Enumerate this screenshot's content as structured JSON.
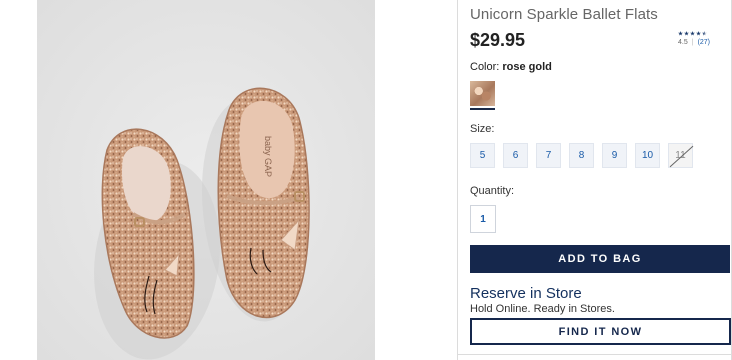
{
  "product": {
    "title": "Unicorn Sparkle Ballet Flats",
    "price": "$29.95",
    "image_alt": "Unicorn Sparkle Ballet Flats in rose gold glitter",
    "insole_brand": "baby GAP"
  },
  "rating": {
    "score": "4.5",
    "count": "(27)",
    "stars_value": 4.5,
    "stars_max": 5
  },
  "color": {
    "label": "Color:",
    "value": "rose gold"
  },
  "size": {
    "label": "Size:",
    "options": [
      {
        "label": "5",
        "available": true
      },
      {
        "label": "6",
        "available": true
      },
      {
        "label": "7",
        "available": true
      },
      {
        "label": "8",
        "available": true
      },
      {
        "label": "9",
        "available": true
      },
      {
        "label": "10",
        "available": true
      },
      {
        "label": "11",
        "available": false
      }
    ]
  },
  "quantity": {
    "label": "Quantity:",
    "value": "1"
  },
  "actions": {
    "add_to_bag": "ADD TO BAG"
  },
  "reserve": {
    "title": "Reserve in Store",
    "subtitle": "Hold Online. Ready in Stores.",
    "button": "FIND IT NOW"
  },
  "colors": {
    "navy": "#15274c",
    "link_blue": "#1a5ba8",
    "shoe_rose_gold": "#d4a88a"
  }
}
